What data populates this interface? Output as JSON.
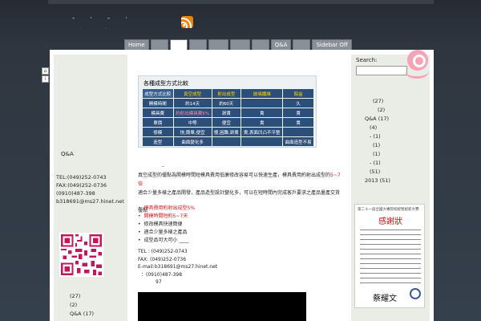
{
  "header": {
    "title": "- · - ·",
    "tagline": ". .",
    "rss_icon": "rss-icon"
  },
  "nav": {
    "tabs": [
      "Home",
      "",
      "",
      "",
      "",
      "",
      "",
      "Q&A",
      "",
      "Sidebar Off"
    ],
    "active_index": 2
  },
  "left_sidebar": {
    "qa_label": "Q&A",
    "contact": {
      "heading": "",
      "tel": "TEL:(049)252-0743",
      "fax": "FAX:(049)252-0736",
      "mobile_label": "",
      "mobile": "(0910)487-398",
      "email": "b318691@ms27.hinet.net",
      "misc": ""
    },
    "archives": [
      {
        "label": "",
        "count": "(27)"
      },
      {
        "label": "",
        "count": "(2)"
      },
      {
        "label": "Q&A",
        "count": "(17)"
      }
    ]
  },
  "comparison": {
    "title": "各種成型方式比較",
    "header_row": [
      "成型方式比較",
      "真空成型",
      "射出成型",
      "玻璃纖維",
      "鋁盒"
    ],
    "rows": [
      [
        "開模時間",
        "約14天",
        "約60天",
        "",
        "久"
      ],
      [
        "模具費",
        "約射出模具費5%",
        "昂貴",
        "貴",
        "貴"
      ],
      [
        "單價",
        "中等",
        "便宜",
        "貴",
        "貴"
      ],
      [
        "修模",
        "快,簡單,便宜",
        "慢,困難,昂貴",
        "貴,表面凹凸不平整",
        ""
      ],
      [
        "造型",
        "曲面變化多",
        "",
        "",
        "曲面造型不易"
      ]
    ]
  },
  "main": {
    "dash": "–",
    "para1_start": "真空成型的優點為開模時間短模具費用低廉修改容易可以快速生產，模具費用約射出成型的",
    "para1_red": "5~7倍",
    "para2": "適合少量多樣之產品開發，產品造型設計變化多，可以在短時間內完成客戶要求之產品量產交貨",
    "section": "優點",
    "bullets": [
      {
        "text": "模具費用約射出成型5%",
        "red": true
      },
      {
        "text": "開模時間短約5~7天",
        "red": true
      },
      {
        "text": "修改模具快速簡便",
        "red": false
      },
      {
        "text": "適合少量多樣之產品",
        "red": false
      },
      {
        "text": "成型品可大可小 ____",
        "red": false
      }
    ],
    "contact": {
      "tel": "TEL : (049)252-0743",
      "fax": "FAX: (049)252-0736",
      "email": "E-mail:b318691@ms27.hinet.net",
      "mobile": "：(0910)487-398",
      "address": "97"
    }
  },
  "right_sidebar": {
    "search_label": "Search:",
    "search_placeholder": "",
    "archives": [
      {
        "label": "",
        "count": "(27)"
      },
      {
        "label": "",
        "count": "(2)"
      },
      {
        "label": "Q&A",
        "count": "(17)"
      },
      {
        "label": "",
        "count": "(4)"
      },
      {
        "label": "-",
        "count": "(1)"
      },
      {
        "label": "",
        "count": "(1)"
      },
      {
        "label": "",
        "count": "(1)"
      },
      {
        "label": "-",
        "count": "(1)"
      },
      {
        "label": "",
        "count": "(51)"
      },
      {
        "label": "2013",
        "count": "(51)"
      }
    ],
    "certificate": {
      "top_text": "第二十一屆全國大專院校經營創新大賽",
      "title": "感謝狀",
      "signature": "蔡耀文"
    }
  }
}
